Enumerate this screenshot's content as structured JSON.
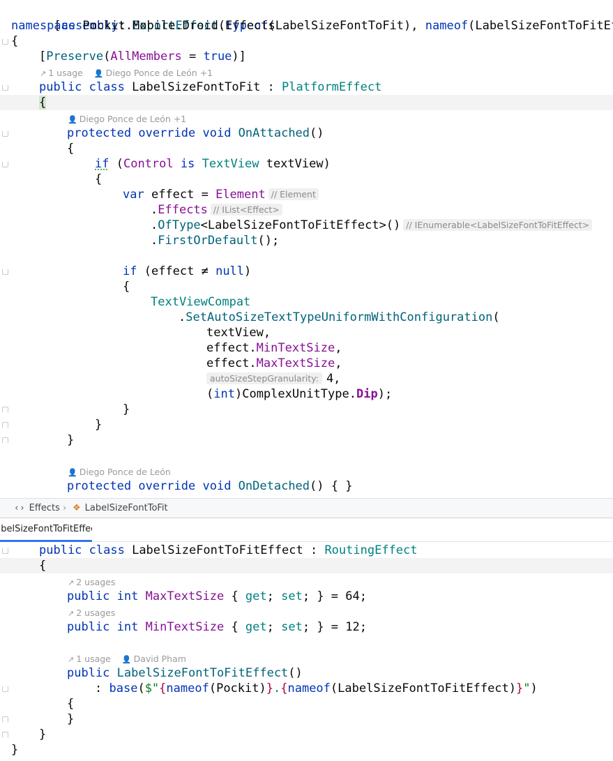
{
  "top_editor": {
    "assembly_line": {
      "open": "[",
      "assembly_kw": "assembly",
      "colon": ": ",
      "export_effect": "ExportEffect",
      "p1": "(",
      "typeof": "typeof",
      "p2": "(",
      "cls1": "LabelSizeFontToFit",
      "p3": "), ",
      "nameof": "nameof",
      "p4": "(",
      "cls2": "LabelSizeFontToFitEffect",
      "close": "))]"
    },
    "namespace_line": {
      "kw": "namespace",
      "name": " Pockit.Mobile.Droid.Effects"
    },
    "brace_open": "{",
    "preserve_line": {
      "open": "[",
      "attr": "Preserve",
      "p1": "(",
      "prop": "AllMembers",
      "eq": " = ",
      "val": "true",
      "close": ")]"
    },
    "hint_class": {
      "usage": "1 usage",
      "author": "Diego Ponce de León +1"
    },
    "class_line": {
      "kw1": "public",
      "kw2": " class",
      "name": " LabelSizeFontToFit",
      "sep": " : ",
      "base": "PlatformEffect"
    },
    "class_brace": "{",
    "hint_onattached": {
      "author": "Diego Ponce de León +1"
    },
    "onattached_line": {
      "kw1": "protected",
      "kw2": " override",
      "kw3": " void",
      "name": " OnAttached",
      "parens": "()"
    },
    "method_brace": "{",
    "if_line": {
      "kw": "if",
      "p": " (",
      "control": "Control",
      "is": " is",
      "type": " TextView",
      "var": " textView",
      "close": ")"
    },
    "if_brace": "{",
    "var_line": {
      "kw": "var",
      "name": " effect = ",
      "element": "Element",
      "hint": "// Element"
    },
    "effects_line": {
      "dot": ".",
      "prop": "Effects",
      "hint": "// IList<Effect>"
    },
    "oftype_line": {
      "dot": ".",
      "fn": "OfType",
      "lt": "<",
      "type": "LabelSizeFontToFitEffect",
      "gt": ">()",
      "hint": "// IEnumerable<LabelSizeFontToFitEffect>"
    },
    "first_line": {
      "dot": ".",
      "fn": "FirstOrDefault",
      "end": "();"
    },
    "if2_line": {
      "kw": "if",
      "cond": " (effect ≠ ",
      "null": "null",
      "close": ")"
    },
    "if2_brace": "{",
    "compat_line": {
      "cls": "TextViewCompat"
    },
    "set_line": {
      "dot": ".",
      "fn": "SetAutoSizeTextTypeUniformWithConfiguration",
      "p": "("
    },
    "arg1": "textView,",
    "arg2": {
      "obj": "effect.",
      "prop": "MinTextSize",
      "comma": ","
    },
    "arg3": {
      "obj": "effect.",
      "prop": "MaxTextSize",
      "comma": ","
    },
    "arg4": {
      "param": "autoSizeStepGranularity:",
      "val": "4,",
      "_": ""
    },
    "arg5": {
      "open": "(",
      "kw": "int",
      "close": ")",
      "enum": "ComplexUnitType.",
      "member": "Dip",
      "end": ");"
    },
    "close_if2": "}",
    "close_if": "}",
    "close_method": "}",
    "hint_ondetached": {
      "author": "Diego Ponce de León"
    },
    "ondetached_line": {
      "kw1": "protected",
      "kw2": " override",
      "kw3": " void",
      "name": " OnDetached",
      "rest": "() { }"
    }
  },
  "breadcrumb": {
    "namespace_label": "Effects",
    "class_label": "LabelSizeFontToFit"
  },
  "tab": {
    "label": "LabelSizeFontToFitEffect.cs"
  },
  "bottom_editor": {
    "class_line": {
      "kw1": "public",
      "kw2": " class",
      "name": " LabelSizeFontToFitEffect",
      "sep": " : ",
      "base": "RoutingEffect"
    },
    "class_brace": "{",
    "hint_max": {
      "usage": "2 usages"
    },
    "max_line": {
      "kw1": "public",
      "kw2": " int",
      "name": " MaxTextSize",
      "b1": " { ",
      "get": "get",
      "s1": "; ",
      "set": "set",
      "s2": "; } = ",
      "val": "64",
      "end": ";"
    },
    "hint_min": {
      "usage": "2 usages"
    },
    "min_line": {
      "kw1": "public",
      "kw2": " int",
      "name": " MinTextSize",
      "b1": " { ",
      "get": "get",
      "s1": "; ",
      "set": "set",
      "s2": "; } = ",
      "val": "12",
      "end": ";"
    },
    "hint_ctor": {
      "usage": "1 usage",
      "author": "David Pham"
    },
    "ctor_line": {
      "kw1": "public",
      "name": " LabelSizeFontToFitEffect",
      "parens": "()"
    },
    "base_line": {
      "colon": ": ",
      "kw": "base",
      "p": "(",
      "s1": "$\"",
      "b1": "{",
      "nameof1": "nameof",
      "arg1": "(Pockit)",
      "b2": "}",
      "dot": ".",
      "b3": "{",
      "nameof2": "nameof",
      "arg2": "(LabelSizeFontToFitEffect)",
      "b4": "}",
      "s2": "\"",
      "end": ")"
    },
    "ctor_open": "{",
    "ctor_close": "}",
    "class_close": "}",
    "ns_close": "}"
  }
}
